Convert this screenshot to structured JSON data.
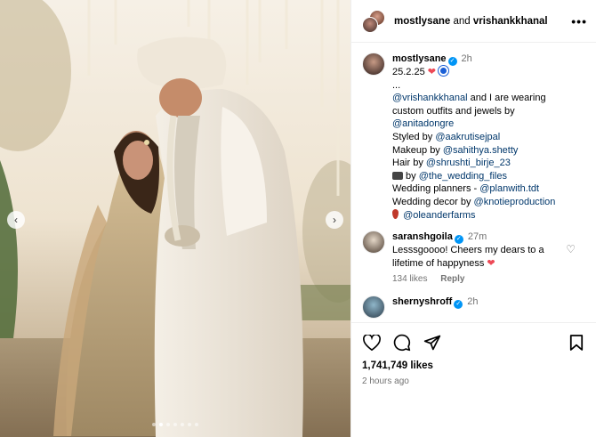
{
  "photo": {
    "slide_count": 7,
    "active_slide": 1
  },
  "post_header": {
    "user1": "mostlysane",
    "joiner": "and",
    "user2": "vrishankkhanal",
    "more_label": "•••"
  },
  "caption": {
    "username": "mostlysane",
    "time": "2h",
    "date_line": "25.2.25",
    "ellipsis": "...",
    "l1_link": "@vrishankkhanal",
    "l1_text": " and I are wearing",
    "l2_text": "custom outfits and jewels by",
    "l3_link": "@anitadongre",
    "l4_text": "Styled by ",
    "l4_link": "@aakrutisejpal",
    "l5_text": "Makeup by ",
    "l5_link": "@sahithya.shetty",
    "l6_text": "Hair by ",
    "l6_link": "@shrushti_birje_23",
    "l7_text": " by ",
    "l7_link": "@the_wedding_files",
    "l8_text": "Wedding planners - ",
    "l8_link": "@planwith.tdt",
    "l9_text": "Wedding decor by ",
    "l9_link": "@knotieproduction",
    "l10_link": "@oleanderfarms"
  },
  "comments": [
    {
      "username": "saranshgoila",
      "time": "27m",
      "text_line1": "Lesssgoooo! Cheers my dears to a",
      "text_line2": "lifetime of happyness",
      "likes": "134 likes",
      "reply": "Reply"
    },
    {
      "username": "shernyshroff",
      "time": "2h"
    }
  ],
  "actions": {
    "likes": "1,741,749 likes",
    "time_ago": "2 hours ago"
  },
  "colors": {
    "link": "#00376b",
    "verified": "#0095f6",
    "muted": "#737373",
    "heart": "#ed4956"
  }
}
